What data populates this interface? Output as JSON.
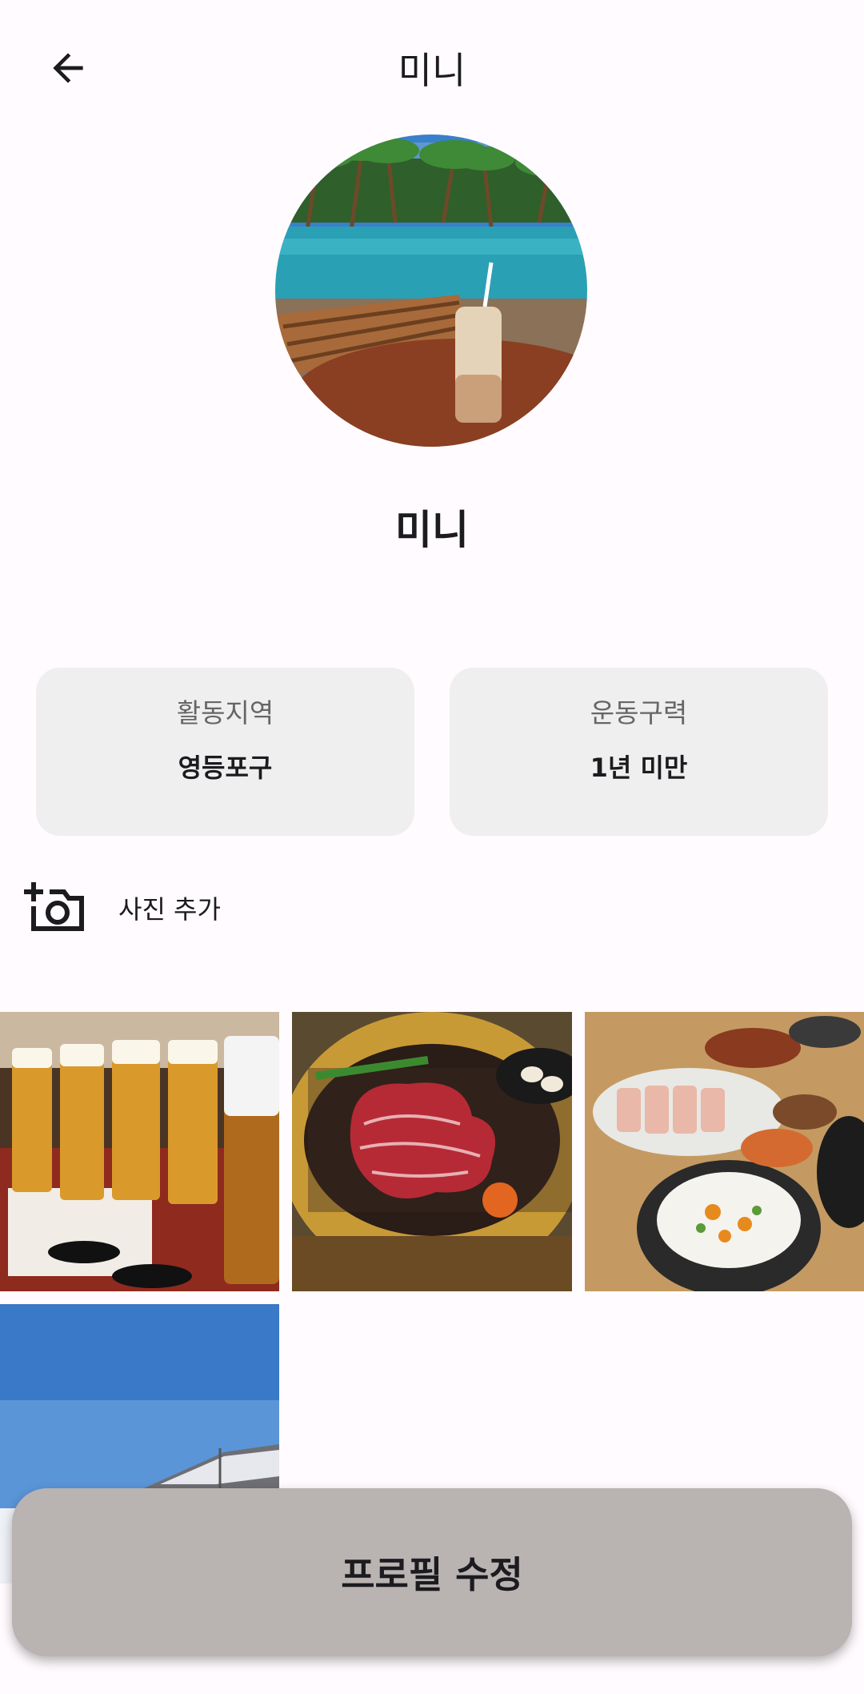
{
  "header": {
    "title": "미니",
    "back_icon": "arrow-back-icon"
  },
  "profile": {
    "name": "미니",
    "avatar_alt": "profile-photo"
  },
  "info_cards": [
    {
      "label": "활동지역",
      "value": "영등포구"
    },
    {
      "label": "운동구력",
      "value": "1년 미만"
    }
  ],
  "add_photo": {
    "label": "사진 추가",
    "icon": "add-camera-icon"
  },
  "photos": [
    "beer-glasses-photo",
    "beef-grill-photo",
    "korean-dishes-photo",
    "snowy-mountain-photo"
  ],
  "edit_button": {
    "label": "프로필 수정"
  },
  "colors": {
    "background": "#fffbfe",
    "card": "#efefef",
    "button": "#b9b3b2",
    "text": "#1c1b1f"
  }
}
